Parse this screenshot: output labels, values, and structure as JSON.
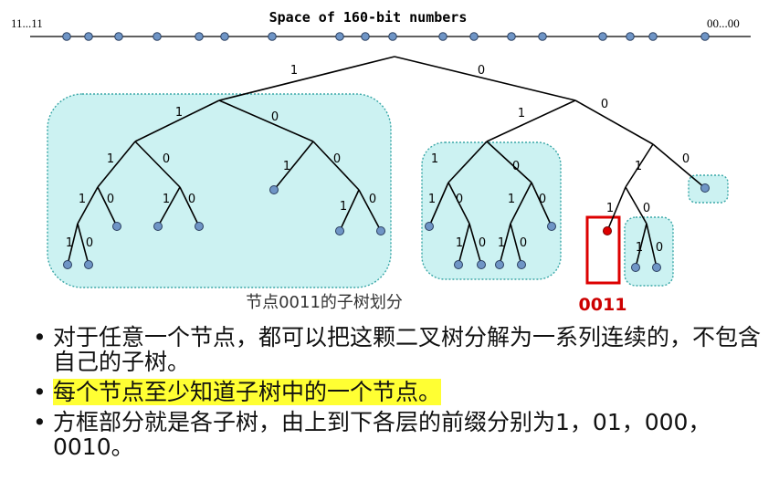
{
  "number_line": {
    "title": "Space of 160-bit numbers",
    "left_label": "11...11",
    "right_label": "00...00"
  },
  "edge_labels": {
    "one": "1",
    "zero": "0"
  },
  "caption": "节点0011的子树划分",
  "target_label": "0011",
  "colors": {
    "subtree_fill": "#ccf2f2",
    "subtree_border": "#3aa7a7",
    "node_fill": "#6f95c6",
    "target_node": "#dd0000",
    "highlight": "#ffff33"
  },
  "bullets": [
    "对于任意一个节点，都可以把这颗二叉树分解为一系列连续的，不包含自己的子树。",
    "每个节点至少知道子树中的一个节点。",
    "方框部分就是各子树，由上到下各层的前缀分别为1，01，000，0010。"
  ]
}
